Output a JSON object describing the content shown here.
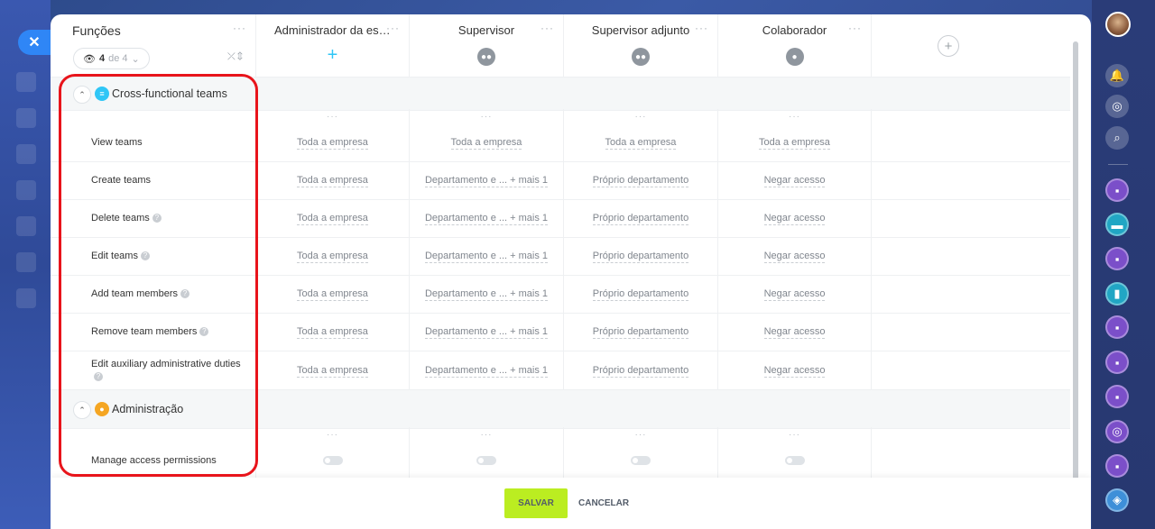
{
  "panel": {
    "functions_title": "Funções",
    "filter": {
      "current": "4",
      "of": "de 4"
    },
    "columns": [
      {
        "title": "Administrador da estru...",
        "icon": "plus-icon"
      },
      {
        "title": "Supervisor",
        "icon": "group-icon"
      },
      {
        "title": "Supervisor adjunto",
        "icon": "group-icon"
      },
      {
        "title": "Colaborador",
        "icon": "user-icon"
      }
    ],
    "menu_dots": "···"
  },
  "sections": [
    {
      "title": "Cross-functional teams",
      "icon_color": "#2fc6f6",
      "rows": [
        {
          "label": "View teams",
          "help": false,
          "values": [
            "Toda a empresa",
            "Toda a empresa",
            "Toda a empresa",
            "Toda a empresa"
          ]
        },
        {
          "label": "Create teams",
          "help": false,
          "values": [
            "Toda a empresa",
            "Departamento e ... + mais 1",
            "Próprio departamento",
            "Negar acesso"
          ]
        },
        {
          "label": "Delete teams",
          "help": true,
          "values": [
            "Toda a empresa",
            "Departamento e ... + mais 1",
            "Próprio departamento",
            "Negar acesso"
          ]
        },
        {
          "label": "Edit teams",
          "help": true,
          "values": [
            "Toda a empresa",
            "Departamento e ... + mais 1",
            "Próprio departamento",
            "Negar acesso"
          ]
        },
        {
          "label": "Add team members",
          "help": true,
          "values": [
            "Toda a empresa",
            "Departamento e ... + mais 1",
            "Próprio departamento",
            "Negar acesso"
          ]
        },
        {
          "label": "Remove team members",
          "help": true,
          "values": [
            "Toda a empresa",
            "Departamento e ... + mais 1",
            "Próprio departamento",
            "Negar acesso"
          ]
        },
        {
          "label": "Edit auxiliary administrative duties",
          "help": true,
          "values": [
            "Toda a empresa",
            "Departamento e ... + mais 1",
            "Próprio departamento",
            "Negar acesso"
          ]
        }
      ]
    },
    {
      "title": "Administração",
      "icon_color": "#f5a623",
      "rows": [
        {
          "label": "Manage access permissions",
          "help": false,
          "toggles": [
            false,
            false,
            false,
            false
          ]
        }
      ]
    }
  ],
  "footer": {
    "save_label": "SALVAR",
    "cancel_label": "CANCELAR"
  },
  "colors": {
    "accent_blue": "#2f86f6",
    "save_green": "#bbed21",
    "highlight_red": "#e8141b"
  }
}
